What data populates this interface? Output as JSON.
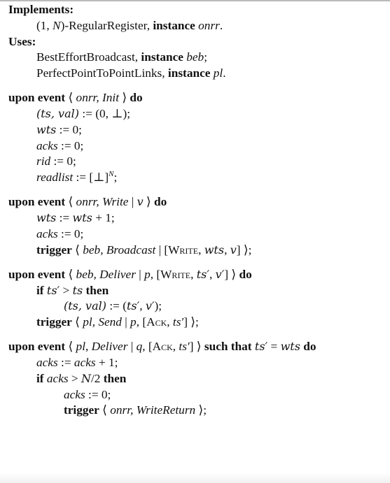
{
  "algorithm": {
    "lines": [
      {
        "indent": 0,
        "segments": [
          {
            "t": "Implements:",
            "s": "b"
          }
        ]
      },
      {
        "indent": 1,
        "segments": [
          {
            "t": "(1, "
          },
          {
            "t": "N",
            "s": "i"
          },
          {
            "t": ")-RegularRegister, "
          },
          {
            "t": "instance",
            "s": "b"
          },
          {
            "t": " "
          },
          {
            "t": "onrr",
            "s": "i"
          },
          {
            "t": "."
          }
        ]
      },
      {
        "indent": 0,
        "segments": [
          {
            "t": "Uses:",
            "s": "b"
          }
        ]
      },
      {
        "indent": 1,
        "segments": [
          {
            "t": "BestEffortBroadcast, "
          },
          {
            "t": "instance",
            "s": "b"
          },
          {
            "t": " "
          },
          {
            "t": "beb",
            "s": "i"
          },
          {
            "t": ";"
          }
        ]
      },
      {
        "indent": 1,
        "segments": [
          {
            "t": "PerfectPointToPointLinks, "
          },
          {
            "t": "instance",
            "s": "b"
          },
          {
            "t": " "
          },
          {
            "t": "pl",
            "s": "i"
          },
          {
            "t": "."
          }
        ]
      },
      {
        "indent": 0,
        "gap": true,
        "segments": [
          {
            "t": "upon event",
            "s": "b"
          },
          {
            "t": " ⟨ "
          },
          {
            "t": "onrr, Init",
            "s": "i"
          },
          {
            "t": " ⟩ "
          },
          {
            "t": "do",
            "s": "b"
          }
        ]
      },
      {
        "indent": 1,
        "segments": [
          {
            "t": "(ts, val)",
            "s": "m"
          },
          {
            "t": " := (0, ⊥);"
          }
        ]
      },
      {
        "indent": 1,
        "segments": [
          {
            "t": "wts",
            "s": "m"
          },
          {
            "t": " := 0;"
          }
        ]
      },
      {
        "indent": 1,
        "segments": [
          {
            "t": "acks",
            "s": "i"
          },
          {
            "t": " := 0;"
          }
        ]
      },
      {
        "indent": 1,
        "segments": [
          {
            "t": "rid",
            "s": "i"
          },
          {
            "t": " := 0;"
          }
        ]
      },
      {
        "indent": 1,
        "segments": [
          {
            "t": "readlist",
            "s": "i"
          },
          {
            "t": " := [⊥]"
          },
          {
            "t": "N",
            "s": "sup"
          },
          {
            "t": ";"
          }
        ]
      },
      {
        "indent": 0,
        "gap": true,
        "segments": [
          {
            "t": "upon event",
            "s": "b"
          },
          {
            "t": " ⟨ "
          },
          {
            "t": "onrr, Write",
            "s": "i"
          },
          {
            "t": " | "
          },
          {
            "t": "v",
            "s": "m"
          },
          {
            "t": " ⟩ "
          },
          {
            "t": "do",
            "s": "b"
          }
        ]
      },
      {
        "indent": 1,
        "segments": [
          {
            "t": "wts",
            "s": "m"
          },
          {
            "t": " := "
          },
          {
            "t": "wts",
            "s": "m"
          },
          {
            "t": " + 1;"
          }
        ]
      },
      {
        "indent": 1,
        "segments": [
          {
            "t": "acks",
            "s": "i"
          },
          {
            "t": " := 0;"
          }
        ]
      },
      {
        "indent": 1,
        "segments": [
          {
            "t": "trigger",
            "s": "b"
          },
          {
            "t": " ⟨ "
          },
          {
            "t": "beb, Broadcast",
            "s": "i"
          },
          {
            "t": " | ["
          },
          {
            "t": "Write",
            "s": "sc"
          },
          {
            "t": ", "
          },
          {
            "t": "wts",
            "s": "m"
          },
          {
            "t": ", "
          },
          {
            "t": "v",
            "s": "m"
          },
          {
            "t": "] ⟩;"
          }
        ]
      },
      {
        "indent": 0,
        "gap": true,
        "segments": [
          {
            "t": "upon event",
            "s": "b"
          },
          {
            "t": " ⟨ "
          },
          {
            "t": "beb, Deliver",
            "s": "i"
          },
          {
            "t": " | "
          },
          {
            "t": "p",
            "s": "i"
          },
          {
            "t": ", ["
          },
          {
            "t": "Write",
            "s": "sc"
          },
          {
            "t": ", "
          },
          {
            "t": "ts′",
            "s": "m"
          },
          {
            "t": ", "
          },
          {
            "t": "v′",
            "s": "m"
          },
          {
            "t": "] ⟩ "
          },
          {
            "t": "do",
            "s": "b"
          }
        ]
      },
      {
        "indent": 1,
        "segments": [
          {
            "t": "if",
            "s": "b"
          },
          {
            "t": " "
          },
          {
            "t": "ts′",
            "s": "m"
          },
          {
            "t": " > "
          },
          {
            "t": "ts",
            "s": "m"
          },
          {
            "t": " "
          },
          {
            "t": "then",
            "s": "b"
          }
        ]
      },
      {
        "indent": 2,
        "segments": [
          {
            "t": "(ts, val)",
            "s": "m"
          },
          {
            "t": " := ("
          },
          {
            "t": "ts′",
            "s": "m"
          },
          {
            "t": ", "
          },
          {
            "t": "v′",
            "s": "m"
          },
          {
            "t": ");"
          }
        ]
      },
      {
        "indent": 1,
        "segments": [
          {
            "t": "trigger",
            "s": "b"
          },
          {
            "t": " ⟨ "
          },
          {
            "t": "pl, Send",
            "s": "i"
          },
          {
            "t": " | "
          },
          {
            "t": "p",
            "s": "i"
          },
          {
            "t": ", ["
          },
          {
            "t": "Ack",
            "s": "sc"
          },
          {
            "t": ", "
          },
          {
            "t": "ts′",
            "s": "i"
          },
          {
            "t": "] ⟩;"
          }
        ]
      },
      {
        "indent": 0,
        "gap": true,
        "segments": [
          {
            "t": "upon event",
            "s": "b"
          },
          {
            "t": " ⟨ "
          },
          {
            "t": "pl, Deliver",
            "s": "i"
          },
          {
            "t": " | "
          },
          {
            "t": "q",
            "s": "i"
          },
          {
            "t": ", ["
          },
          {
            "t": "Ack",
            "s": "sc"
          },
          {
            "t": ", "
          },
          {
            "t": "ts′",
            "s": "i"
          },
          {
            "t": "] ⟩ "
          },
          {
            "t": "such that",
            "s": "b"
          },
          {
            "t": " "
          },
          {
            "t": "ts′",
            "s": "m"
          },
          {
            "t": " = "
          },
          {
            "t": "wts",
            "s": "m"
          },
          {
            "t": " "
          },
          {
            "t": "do",
            "s": "b"
          }
        ]
      },
      {
        "indent": 1,
        "segments": [
          {
            "t": "acks",
            "s": "i"
          },
          {
            "t": " := "
          },
          {
            "t": "acks",
            "s": "i"
          },
          {
            "t": " + 1;"
          }
        ]
      },
      {
        "indent": 1,
        "segments": [
          {
            "t": "if",
            "s": "b"
          },
          {
            "t": " "
          },
          {
            "t": "acks",
            "s": "i"
          },
          {
            "t": " > "
          },
          {
            "t": "N",
            "s": "m"
          },
          {
            "t": "/2 "
          },
          {
            "t": "then",
            "s": "b"
          }
        ]
      },
      {
        "indent": 2,
        "segments": [
          {
            "t": "acks",
            "s": "i"
          },
          {
            "t": " := 0;"
          }
        ]
      },
      {
        "indent": 2,
        "segments": [
          {
            "t": "trigger",
            "s": "b"
          },
          {
            "t": " ⟨ "
          },
          {
            "t": "onrr, WriteReturn",
            "s": "i"
          },
          {
            "t": " ⟩;"
          }
        ]
      }
    ]
  }
}
